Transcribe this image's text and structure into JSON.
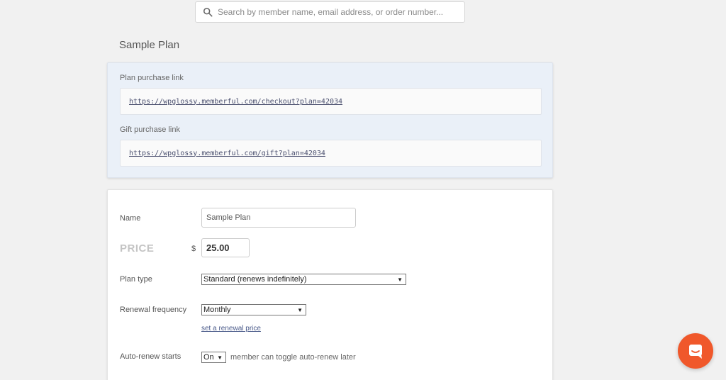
{
  "search": {
    "placeholder": "Search by member name, email address, or order number...",
    "icon": "search-icon"
  },
  "page": {
    "title": "Sample Plan"
  },
  "links": {
    "plan_label": "Plan purchase link",
    "plan_url": "https://wpglossy.memberful.com/checkout?plan=42034",
    "gift_label": "Gift purchase link",
    "gift_url": "https://wpglossy.memberful.com/gift?plan=42034"
  },
  "form": {
    "name_label": "Name",
    "name_value": "Sample Plan",
    "price_label": "PRICE",
    "currency_symbol": "$",
    "price_value": "25.00",
    "plan_type_label": "Plan type",
    "plan_type_value": "Standard (renews indefinitely)",
    "renewal_label": "Renewal frequency",
    "renewal_value": "Monthly",
    "renewal_price_link": "set a renewal price",
    "autorenew_label": "Auto-renew starts",
    "autorenew_value": "On",
    "autorenew_helper": "member can toggle auto-renew later"
  },
  "chat": {
    "icon": "chat-icon",
    "color": "#f0582b"
  }
}
